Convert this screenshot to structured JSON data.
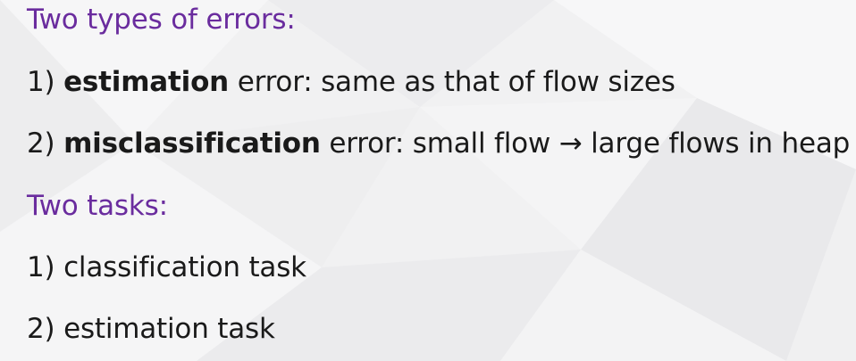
{
  "section_types": {
    "heading": "Two types of errors:",
    "items": [
      {
        "prefix": "1) ",
        "term": "estimation",
        "rest": " error: same as that of flow sizes"
      },
      {
        "prefix": "2) ",
        "term": "misclassification",
        "rest": " error: small flow → large flows in heap"
      }
    ]
  },
  "section_tasks": {
    "heading": "Two tasks:",
    "items": [
      {
        "text": "1) classification task"
      },
      {
        "text": "2) estimation task"
      }
    ]
  },
  "colors": {
    "heading": "#6a2c9e",
    "body_text": "#1a1a1a",
    "background": "#f1f1f2"
  }
}
